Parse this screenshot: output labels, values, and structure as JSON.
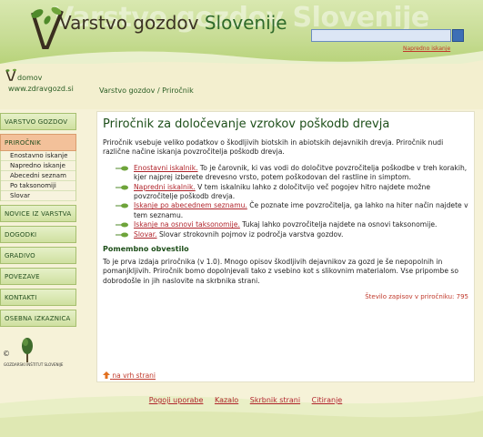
{
  "header": {
    "title_part1": "Varstvo gozdov",
    "title_part2": "Slovenije",
    "bg_text": "Varstvo gozdov Slovenije",
    "search_placeholder": "",
    "advanced_search": "Napredno iskanje"
  },
  "top": {
    "home": "domov",
    "url": "www.zdravgozd.si",
    "breadcrumb": "Varstvo gozdov / Priročnik"
  },
  "sidebar": {
    "items": [
      {
        "label": "VARSTVO GOZDOV"
      },
      {
        "label": "PRIROČNIK"
      },
      {
        "label": "NOVICE IZ VARSTVA"
      },
      {
        "label": "DOGODKI"
      },
      {
        "label": "GRADIVO"
      },
      {
        "label": "POVEZAVE"
      },
      {
        "label": "KONTAKTI"
      },
      {
        "label": "OSEBNA IZKAZNICA"
      }
    ],
    "subitems": [
      {
        "label": "Enostavno iskanje"
      },
      {
        "label": "Napredno iskanje"
      },
      {
        "label": "Abecedni seznam"
      },
      {
        "label": "Po taksonomiji"
      },
      {
        "label": "Slovar"
      }
    ],
    "copyright": "©",
    "institute": "GOZDARSKI INŠTITUT SLOVENIJE"
  },
  "content": {
    "title": "Priročnik za določevanje vzrokov poškodb drevja",
    "intro": "Priročnik vsebuje veliko podatkov o škodljivih biotskih in abiotskih dejavnikih drevja. Priročnik nudi različne načine iskanja povzročitelja poškodb drevja.",
    "items": [
      {
        "link": "Enostavni iskalnik.",
        "text": " To je čarovnik, ki vas vodi do določitve povzročitelja poškodbe v treh korakih, kjer najprej izberete drevesno vrsto, potem poškodovan del rastline in simptom."
      },
      {
        "link": "Napredni iskalnik.",
        "text": " V tem iskalniku lahko z določitvijo več pogojev hitro najdete možne povzročitelje poškodb drevja."
      },
      {
        "link": "Iskanje po abecednem seznamu.",
        "text": " Če poznate ime povzročitelja, ga lahko na hiter način najdete v tem seznamu."
      },
      {
        "link": "Iskanje na osnovi taksonomije.",
        "text": " Tukaj lahko povzročitelja najdete na osnovi taksonomije."
      },
      {
        "link": "Slovar.",
        "text": " Slovar strokovnih pojmov iz področja varstva gozdov."
      }
    ],
    "subheading": "Pomembno obvestilo",
    "notice": "To je prva izdaja priročnika (v 1.0). Mnogo opisov škodljivih dejavnikov za gozd je še nepopolnih in pomanjkljivih. Priročnik bomo dopolnjevali tako z vsebino kot s slikovnim materialom. Vse pripombe so dobrodošle in jih naslovite na skrbnika strani.",
    "counter": "Število zapisov v priročniku: 795",
    "to_top": "na vrh strani"
  },
  "footer": {
    "links": [
      {
        "label": "Pogoji uporabe"
      },
      {
        "label": "Kazalo"
      },
      {
        "label": "Skrbnik strani"
      },
      {
        "label": "Citiranje"
      }
    ]
  },
  "colors": {
    "accent_green": "#1e4f1a",
    "link_red": "#b0242b",
    "active_menu": "#f3c19a"
  }
}
